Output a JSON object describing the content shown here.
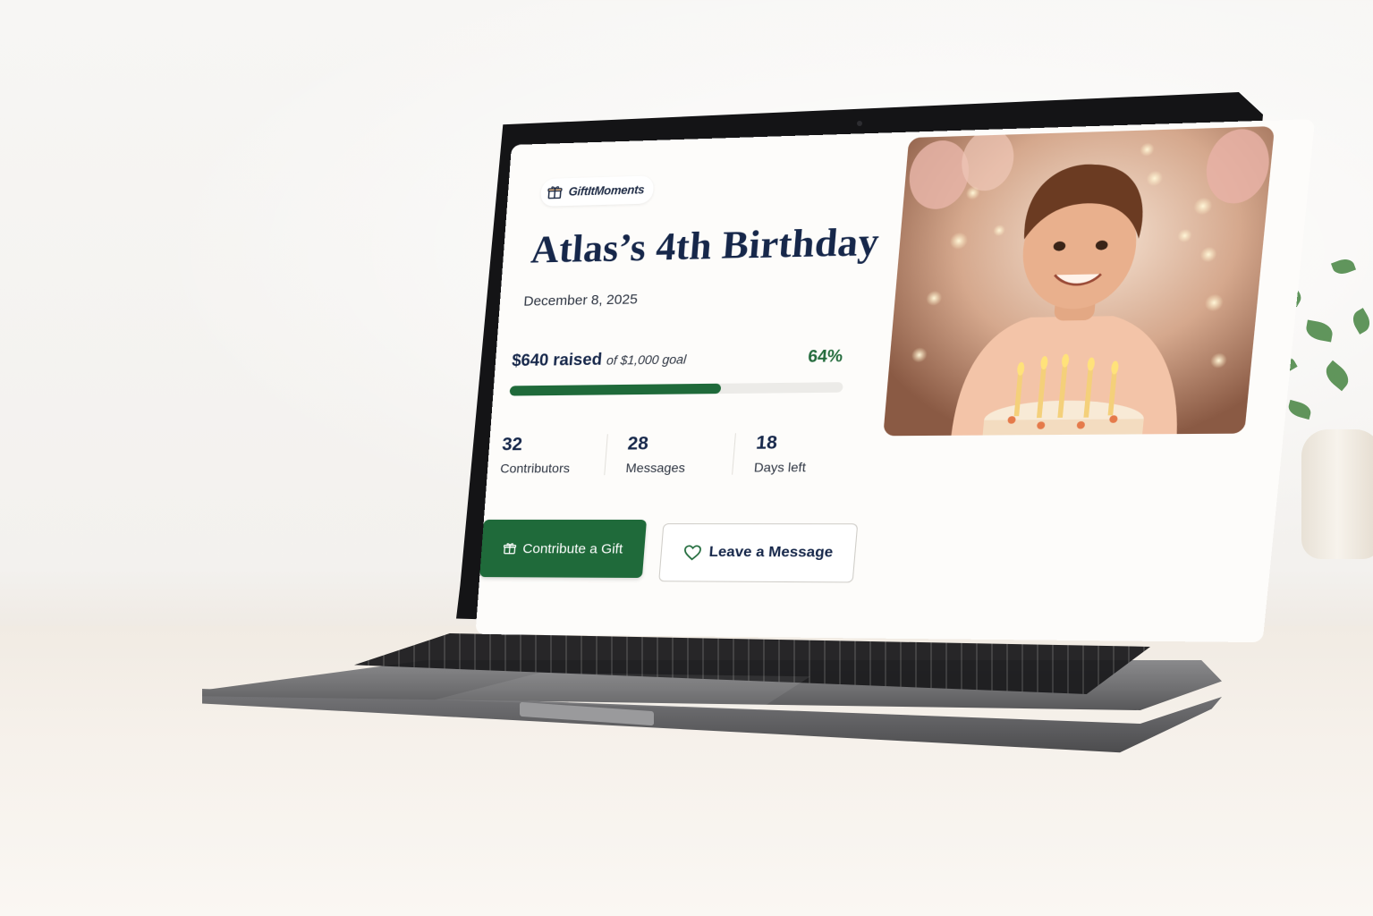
{
  "app": {
    "brand_name": "GiftItMoments",
    "brand_icon": "gift-icon"
  },
  "event": {
    "title": "Atlas’s 4th Birthday",
    "date": "December 8, 2025"
  },
  "fundraising": {
    "raised_amount": "$640 raised",
    "goal_text": "of $1,000 goal",
    "percent_label": "64%",
    "progress_fraction": 0.64
  },
  "stats": [
    {
      "value": "32",
      "label": "Contributors"
    },
    {
      "value": "28",
      "label": "Messages"
    },
    {
      "value": "18",
      "label": "Days left"
    }
  ],
  "actions": {
    "contribute_label": "Contribute a Gift",
    "contribute_icon": "gift-icon",
    "message_label": "Leave a Message",
    "message_icon": "heart-icon"
  },
  "photo": {
    "description_icon": "birthday-photo"
  },
  "colors": {
    "primary_green": "#1f6a3a",
    "navy": "#16274a",
    "accent_green_text": "#236b3c"
  }
}
